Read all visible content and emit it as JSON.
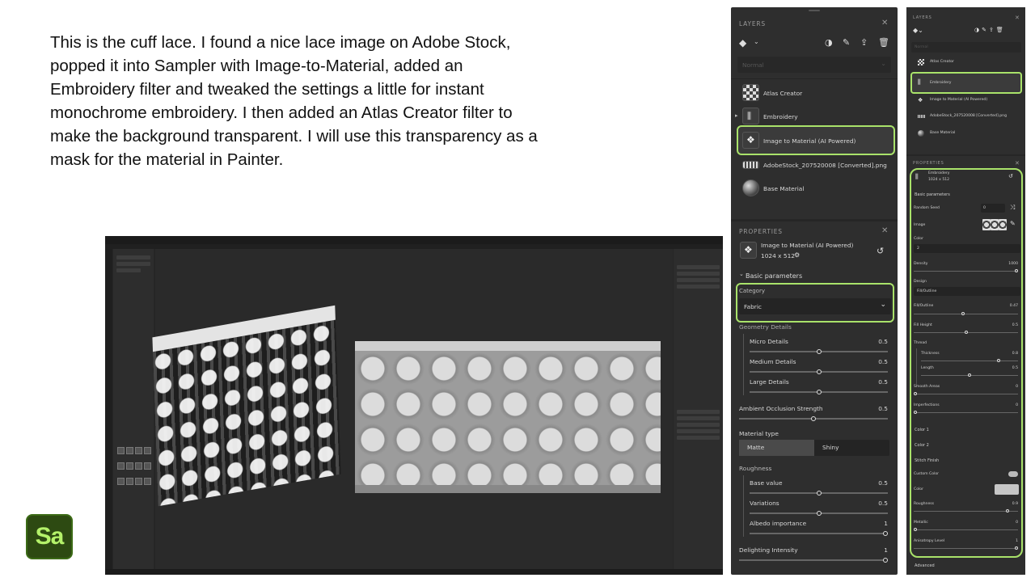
{
  "intro": {
    "lines": [
      "This is the cuff lace. I found a nice lace image on Adobe Stock,",
      "popped it into Sampler with Image-to-Material, added an",
      "Embroidery filter and tweaked the settings a little for instant",
      "monochrome embroidery. I then added an Atlas Creator filter to",
      "make the background transparent. I will use this transparency as a",
      "mask for the material in Painter."
    ]
  },
  "logo": {
    "text": "Sa"
  },
  "colors": {
    "accent": "#a9e26a",
    "panel": "#2e2e2e",
    "logo_bg": "#2d4a12",
    "logo_fg": "#b4f26a"
  },
  "layers_panel": {
    "title": "LAYERS",
    "blend": "Normal",
    "layers": [
      {
        "name": "Atlas Creator",
        "icon": "checker-icon"
      },
      {
        "name": "Embroidery",
        "icon": "filter-icon"
      },
      {
        "name": "Image to Material (AI Powered)",
        "icon": "ai-material-icon"
      },
      {
        "name": "AdobeStock_207520008 [Converted].png",
        "icon": "image-icon"
      },
      {
        "name": "Base Material",
        "icon": "sphere-icon"
      }
    ]
  },
  "properties_panel": {
    "title": "PROPERTIES",
    "layer_name": "Image to Material (AI Powered)",
    "resolution": "1024 x 512",
    "section": "Basic parameters",
    "category_label": "Category",
    "category_value": "Fabric",
    "geometry_label": "Geometry Details",
    "micro": {
      "label": "Micro Details",
      "value": "0.5"
    },
    "medium": {
      "label": "Medium Details",
      "value": "0.5"
    },
    "large": {
      "label": "Large Details",
      "value": "0.5"
    },
    "ao": {
      "label": "Ambient Occlusion Strength",
      "value": "0.5"
    },
    "material_type_label": "Material type",
    "matte": "Matte",
    "shiny": "Shiny",
    "roughness_label": "Roughness",
    "base": {
      "label": "Base value",
      "value": "0.5"
    },
    "variations": {
      "label": "Variations",
      "value": "0.5"
    },
    "albedo": {
      "label": "Albedo importance",
      "value": "1"
    },
    "delight": {
      "label": "Delighting Intensity",
      "value": "1"
    }
  },
  "panel2": {
    "layers_title": "LAYERS",
    "blend": "Normal",
    "layers": [
      "Atlas Creator",
      "Embroidery",
      "Image to Material (AI Powered)",
      "AdobeStock_207520008 [Converted].png",
      "Base Material"
    ],
    "props_title": "PROPERTIES",
    "layer_name": "Embroidery",
    "resolution": "1024 x 512",
    "section": "Basic parameters",
    "random_seed": {
      "label": "Random Seed",
      "value": "0"
    },
    "image_label": "Image",
    "color_label": "Color",
    "color_value": "2",
    "density": {
      "label": "Density",
      "value": "1000"
    },
    "design_label": "Design",
    "design_value": "Fill/Outline",
    "fill_outline": {
      "label": "Fill/Outline",
      "value": "0.47"
    },
    "fill_height": {
      "label": "Fill Height",
      "value": "0.5"
    },
    "thread_label": "Thread",
    "thickness": {
      "label": "Thickness",
      "value": "0.8"
    },
    "length": {
      "label": "Length",
      "value": "0.5"
    },
    "smooth": {
      "label": "Smooth Areas",
      "value": "0"
    },
    "imperfections": {
      "label": "Imperfections",
      "value": "0"
    },
    "color1": "Color 1",
    "color2": "Color 2",
    "stitch_finish": "Stitch Finish",
    "custom_color": "Custom Color",
    "color_field": "Color",
    "roughness": {
      "label": "Roughness",
      "value": "0.9"
    },
    "metallic": {
      "label": "Metallic",
      "value": "0"
    },
    "anisotropy": {
      "label": "Anisotropy Level",
      "value": "1"
    },
    "advanced": "Advanced"
  },
  "slider_levels": {
    "micro": 0.5,
    "medium": 0.5,
    "large": 0.5,
    "ao": 0.5,
    "base": 0.5,
    "variations": 0.5,
    "albedo": 1,
    "delight": 1,
    "density": 1,
    "fill_outline": 0.47,
    "fill_height": 0.5,
    "thickness": 0.8,
    "length": 0.5,
    "smooth": 0,
    "imperfections": 0,
    "roughness": 0.9,
    "metallic": 0,
    "anisotropy": 1
  }
}
